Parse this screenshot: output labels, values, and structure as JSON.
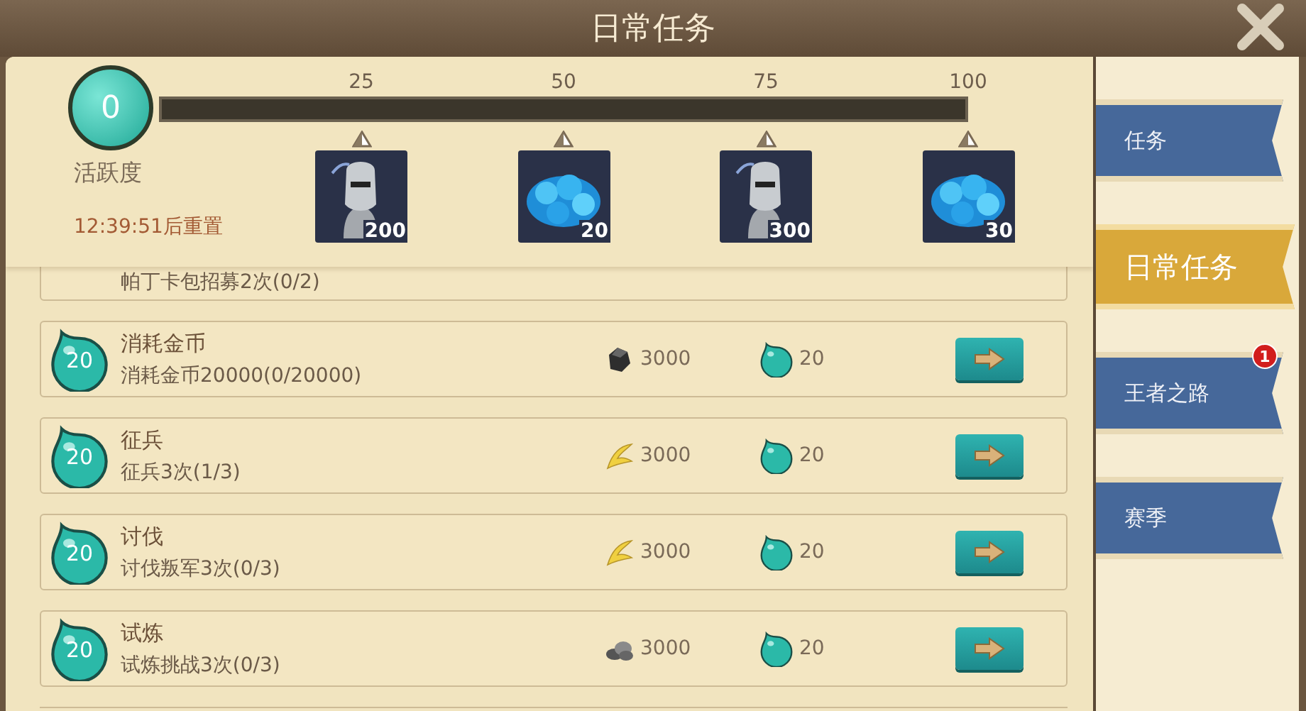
{
  "window": {
    "title": "日常任务"
  },
  "activity": {
    "points": "0",
    "label": "活跃度",
    "reset_timer": "12:39:51后重置",
    "level": 0,
    "milestones": [
      {
        "value": "25",
        "kind": "soldier",
        "amount": "200"
      },
      {
        "value": "50",
        "kind": "gem",
        "amount": "20"
      },
      {
        "value": "75",
        "kind": "soldier",
        "amount": "300"
      },
      {
        "value": "100",
        "kind": "gem",
        "amount": "30"
      }
    ]
  },
  "tasks": [
    {
      "kind": "partial",
      "description": "帕丁卡包招募2次(0/2)"
    },
    {
      "kind": "full",
      "points": "20",
      "title": "消耗金币",
      "description": "消耗金币20000(0/20000)",
      "resource": {
        "kind": "iron",
        "amount": "3000"
      },
      "activity_reward": "20"
    },
    {
      "kind": "full",
      "points": "20",
      "title": "征兵",
      "description": "征兵3次(1/3)",
      "resource": {
        "kind": "grain",
        "amount": "3000"
      },
      "activity_reward": "20"
    },
    {
      "kind": "full",
      "points": "20",
      "title": "讨伐",
      "description": "讨伐叛军3次(0/3)",
      "resource": {
        "kind": "grain",
        "amount": "3000"
      },
      "activity_reward": "20"
    },
    {
      "kind": "full",
      "points": "20",
      "title": "试炼",
      "description": "试炼挑战3次(0/3)",
      "resource": {
        "kind": "stone",
        "amount": "3000"
      },
      "activity_reward": "20"
    }
  ],
  "sidebar": {
    "tabs": [
      {
        "label": "任务",
        "selected": false
      },
      {
        "label": "日常任务",
        "selected": true
      },
      {
        "label": "王者之路",
        "selected": false,
        "badge": "1"
      },
      {
        "label": "赛季",
        "selected": false
      }
    ]
  }
}
